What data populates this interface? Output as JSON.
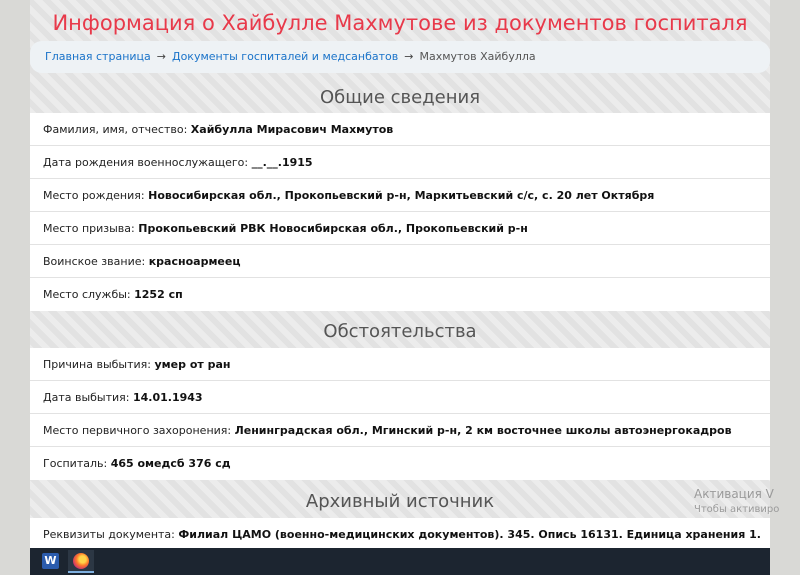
{
  "page": {
    "title": "Информация о Хайбулле Махмутове из документов госпиталя"
  },
  "breadcrumb": {
    "home": "Главная страница",
    "separator": "→",
    "section": "Документы госпиталей и медсанбатов",
    "current": "Махмутов Хайбулла"
  },
  "general": {
    "title": "Общие сведения",
    "rows": [
      {
        "label": "Фамилия, имя, отчество:",
        "value": "Хайбулла Мирасович Махмутов"
      },
      {
        "label": "Дата рождения военнослужащего:",
        "value": "__.__.1915"
      },
      {
        "label": "Место рождения:",
        "value": "Новосибирская обл., Прокопьевский р-н, Маркитьевский с/с, с. 20 лет Октября"
      },
      {
        "label": "Место призыва:",
        "value": "Прокопьевский РВК Новосибирская обл., Прокопьевский р-н"
      },
      {
        "label": "Воинское звание:",
        "value": "красноармеец"
      },
      {
        "label": "Место службы:",
        "value": "1252 сп"
      }
    ]
  },
  "circumstances": {
    "title": "Обстоятельства",
    "rows": [
      {
        "label": "Причина выбытия:",
        "value": "умер от ран"
      },
      {
        "label": "Дата выбытия:",
        "value": "14.01.1943"
      },
      {
        "label": "Место первичного захоронения:",
        "value": "Ленинградская обл., Мгинский р-н, 2 км восточнее школы автоэнергокадров"
      },
      {
        "label": "Госпиталь:",
        "value": "465 омедсб 376 сд"
      }
    ]
  },
  "archive": {
    "title": "Архивный источник",
    "rows": [
      {
        "label": "Реквизиты документа:",
        "value": "Филиал ЦАМО (военно-медицинских документов). 345. Опись 16131. Единица хранения 1."
      }
    ]
  },
  "watermark": {
    "line1": "Активация V",
    "line2": "Чтобы активиро"
  },
  "taskbar": {
    "word_letter": "W",
    "apps": [
      "word-icon",
      "firefox-icon"
    ]
  }
}
